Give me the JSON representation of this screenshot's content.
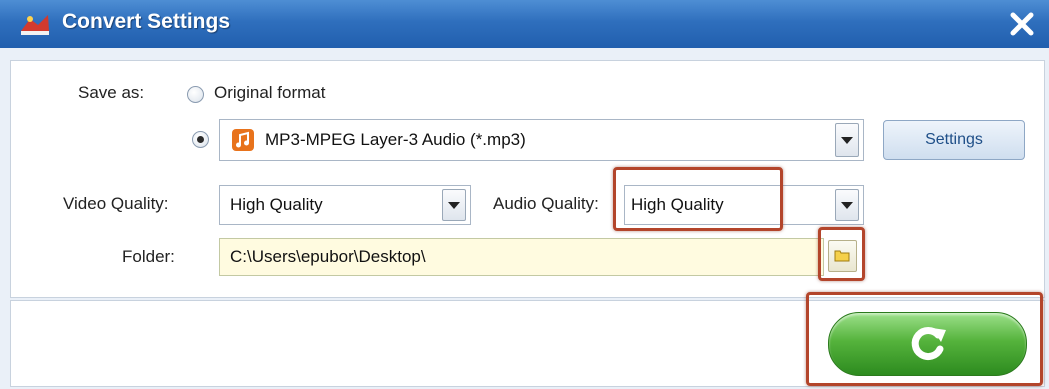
{
  "window": {
    "title": "Convert Settings",
    "icon": "app-logo-icon",
    "close_icon": "close-icon"
  },
  "save_as": {
    "label": "Save as:",
    "option_original": "Original format",
    "selected": "format",
    "format_value": "MP3-MPEG Layer-3 Audio (*.mp3)",
    "format_icon": "music-note-icon",
    "settings_label": "Settings"
  },
  "video_quality": {
    "label": "Video Quality:",
    "value": "High Quality"
  },
  "audio_quality": {
    "label": "Audio Quality:",
    "value": "High Quality"
  },
  "folder": {
    "label": "Folder:",
    "value": "C:\\Users\\epubor\\Desktop\\",
    "browse_icon": "folder-icon"
  },
  "convert": {
    "icon": "refresh-arrow-icon"
  },
  "colors": {
    "title_bar": "#2f6fbd",
    "convert_button": "#55b33c",
    "highlight": "#b3452b",
    "folder_field": "#fffbe0"
  }
}
